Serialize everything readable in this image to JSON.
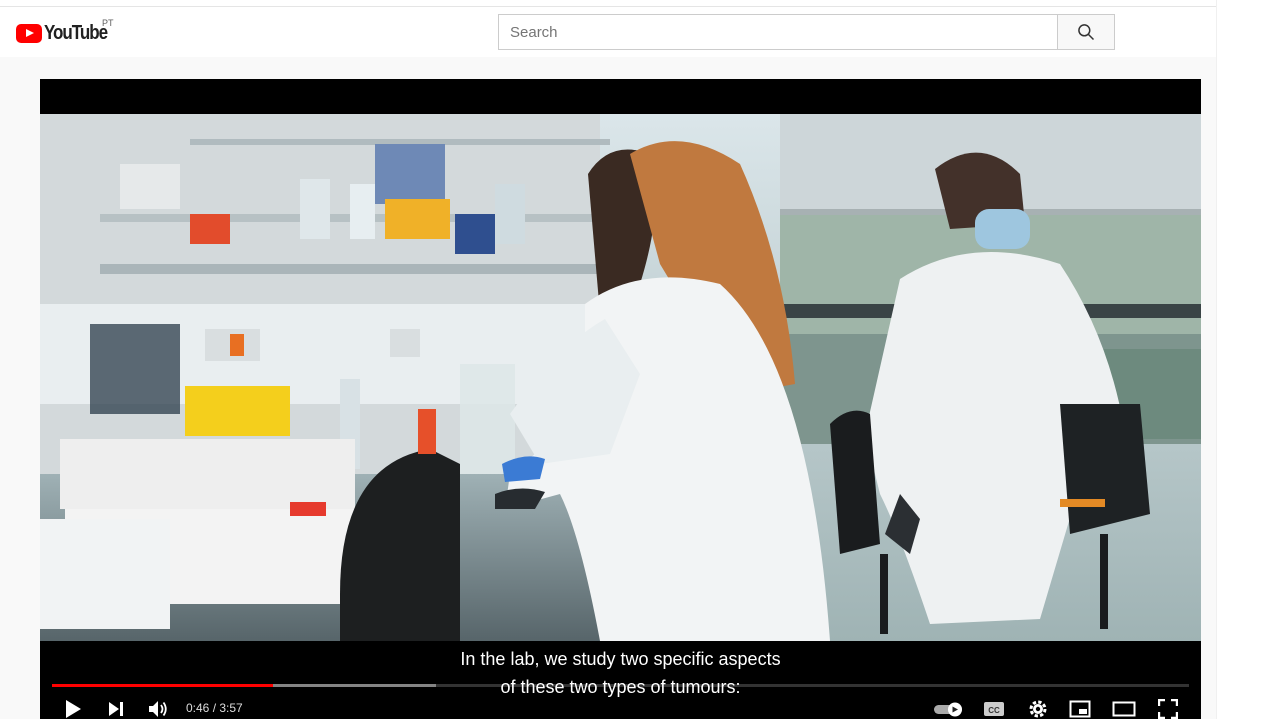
{
  "header": {
    "logo_text": "YouTube",
    "country_code": "PT",
    "search_placeholder": "Search"
  },
  "player": {
    "subtitle_lines": [
      "In the lab, we study two specific aspects",
      "of these two types of tumours:"
    ],
    "current_time": "0:46",
    "duration": "3:57",
    "time_display": "0:46 / 3:57",
    "progress_played_fraction": 0.194,
    "progress_buffered_fraction": 0.338,
    "autoplay": true,
    "controls": [
      "play-icon",
      "next-icon",
      "volume-icon",
      "autoplay-toggle",
      "captions-icon",
      "settings-icon",
      "miniplayer-icon",
      "theater-icon",
      "fullscreen-icon"
    ]
  },
  "colors": {
    "brand_red": "#ff0000",
    "text_dark": "#212121",
    "border": "#cccccc"
  }
}
